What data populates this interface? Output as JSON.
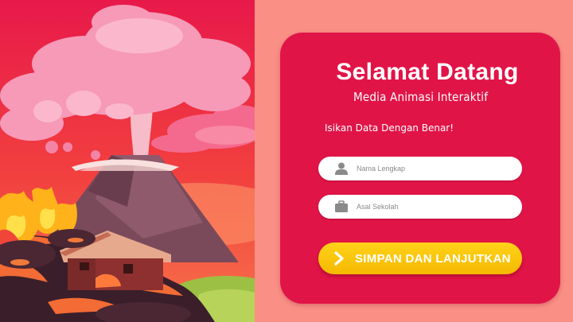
{
  "login": {
    "title": "Selamat Datang",
    "subtitle": "Media Animasi Interaktif",
    "instruction": "Isikan Data Dengan Benar!",
    "name_field": {
      "placeholder": "Nama Lengkap",
      "icon": "user-icon"
    },
    "school_field": {
      "placeholder": "Asal Sekolah",
      "icon": "briefcase-icon"
    },
    "submit_label": "SIMPAN DAN LANJUTKAN",
    "submit_icon": "chevron-right-icon"
  },
  "colors": {
    "background": "#fa8f86",
    "card": "#e11447",
    "button": "#fbc50d",
    "illustration_sky": "#f0404d"
  }
}
